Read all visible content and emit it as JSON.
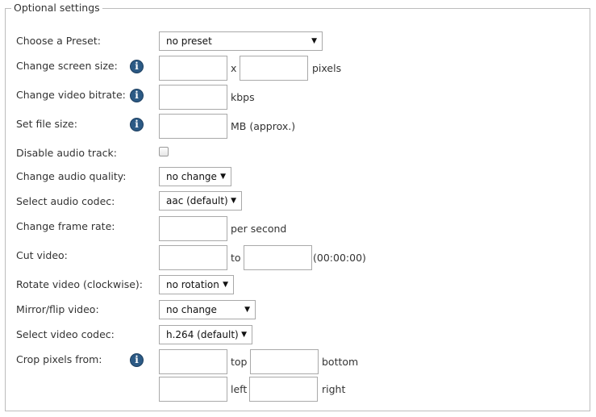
{
  "legend": "Optional settings",
  "rows": {
    "preset": {
      "label": "Choose a Preset:",
      "value": "no preset"
    },
    "screen_size": {
      "label": "Change screen size:",
      "sep": "x",
      "unit": "pixels"
    },
    "bitrate": {
      "label": "Change video bitrate:",
      "unit": "kbps"
    },
    "file_size": {
      "label": "Set file size:",
      "unit": "MB (approx.)"
    },
    "disable_audio": {
      "label": "Disable audio track:",
      "checked": false
    },
    "audio_quality": {
      "label": "Change audio quality:",
      "value": "no change"
    },
    "audio_codec": {
      "label": "Select audio codec:",
      "value": "aac (default)"
    },
    "frame_rate": {
      "label": "Change frame rate:",
      "unit": "per second"
    },
    "cut_video": {
      "label": "Cut video:",
      "sep": "to",
      "unit": "(00:00:00)"
    },
    "rotate": {
      "label": "Rotate video (clockwise):",
      "value": "no rotation"
    },
    "mirror": {
      "label": "Mirror/flip video:",
      "value": "no change"
    },
    "video_codec": {
      "label": "Select video codec:",
      "value": "h.264 (default)"
    },
    "crop": {
      "label": "Crop pixels from:",
      "top": "top",
      "bottom": "bottom",
      "left": "left",
      "right": "right"
    }
  },
  "icons": {
    "info": "info-icon",
    "dropdown": "caret-down-icon"
  },
  "colors": {
    "info_icon": "#2c5a85",
    "border": "#a9a9a9"
  }
}
